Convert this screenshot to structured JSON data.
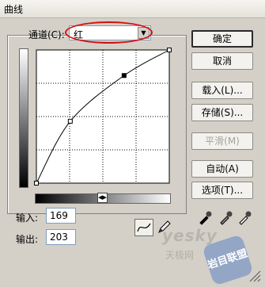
{
  "window": {
    "title": "曲线"
  },
  "channel": {
    "label": "通道(C):",
    "value": "红",
    "dropdown_icon": "chevron-down-icon"
  },
  "curve": {
    "grid_divisions": 4,
    "points_normalized_levels": [
      {
        "input": 0,
        "output": 0
      },
      {
        "input": 0.255,
        "output": 0.465
      },
      {
        "input": 0.66,
        "output": 0.808
      },
      {
        "input": 1,
        "output": 1
      }
    ]
  },
  "fields": {
    "input_label": "输入:",
    "input_value": "169",
    "output_label": "输出:",
    "output_value": "203"
  },
  "buttons": {
    "ok": "确定",
    "cancel": "取消",
    "load": "载入(L)...",
    "save": "存储(S)...",
    "smooth": "平滑(M)",
    "auto": "自动(A)",
    "options": "选项(T)..."
  },
  "tools": {
    "curve_tool": "curve-tool-icon",
    "pencil_tool": "pencil-icon",
    "eyedroppers": [
      "black-eyedropper-icon",
      "gray-eyedropper-icon",
      "white-eyedropper-icon"
    ]
  },
  "watermark": {
    "text": "yesky",
    "sub": "天极网",
    "seal": "岩目联盟"
  },
  "colors": {
    "highlight_oval": "#d31010",
    "dialog_bg": "#d4d0c8"
  }
}
